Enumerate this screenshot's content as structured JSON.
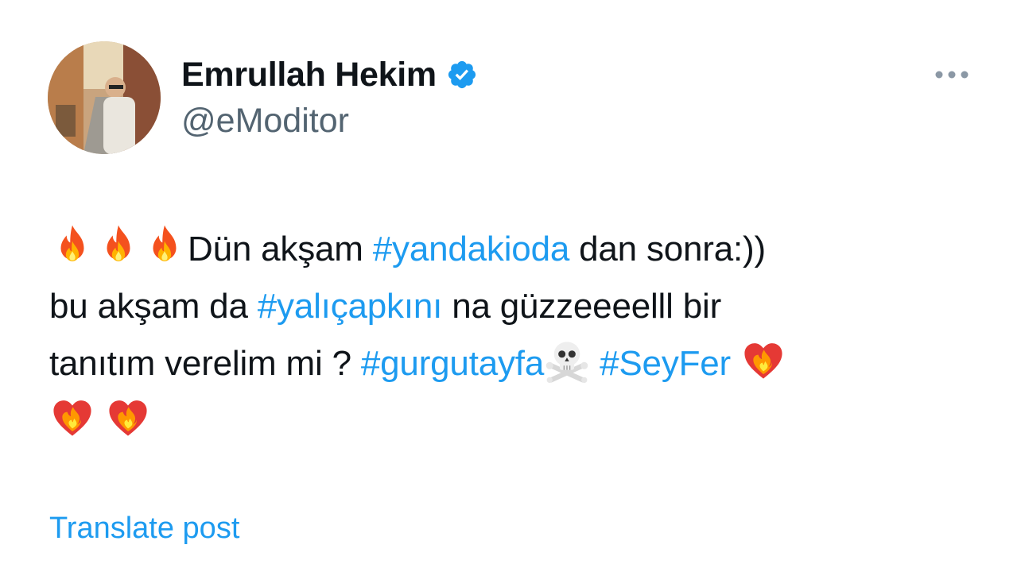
{
  "author": {
    "display_name": "Emrullah Hekim",
    "handle": "@eModitor",
    "verified": true
  },
  "tweet": {
    "segments": [
      {
        "type": "emoji",
        "name": "fire-emoji"
      },
      {
        "type": "emoji",
        "name": "fire-emoji"
      },
      {
        "type": "emoji",
        "name": "fire-emoji"
      },
      {
        "type": "text",
        "value": "Dün akşam "
      },
      {
        "type": "hashtag",
        "value": "#yandakioda"
      },
      {
        "type": "text",
        "value": " dan sonra:))"
      },
      {
        "type": "break"
      },
      {
        "type": "text",
        "value": "bu akşam da "
      },
      {
        "type": "hashtag",
        "value": "#yalıçapkını"
      },
      {
        "type": "text",
        "value": " na güzzeeeelll bir"
      },
      {
        "type": "break"
      },
      {
        "type": "text",
        "value": "tanıtım verelim mi ? "
      },
      {
        "type": "hashtag",
        "value": "#gurgutayfa"
      },
      {
        "type": "emoji",
        "name": "skull-crossbones-emoji"
      },
      {
        "type": "text",
        "value": " "
      },
      {
        "type": "hashtag",
        "value": "#SeyFer"
      },
      {
        "type": "text",
        "value": " "
      },
      {
        "type": "emoji",
        "name": "heart-on-fire-emoji"
      },
      {
        "type": "break"
      },
      {
        "type": "emoji",
        "name": "heart-on-fire-emoji"
      },
      {
        "type": "text",
        "value": " "
      },
      {
        "type": "emoji",
        "name": "heart-on-fire-emoji"
      }
    ]
  },
  "translate_label": "Translate post",
  "colors": {
    "text": "#0f1419",
    "secondary": "#536471",
    "link": "#1d9bf0",
    "verified_badge": "#1d9bf0"
  },
  "icons": {
    "more": "more-horizontal-icon",
    "verified": "verified-badge-icon"
  }
}
